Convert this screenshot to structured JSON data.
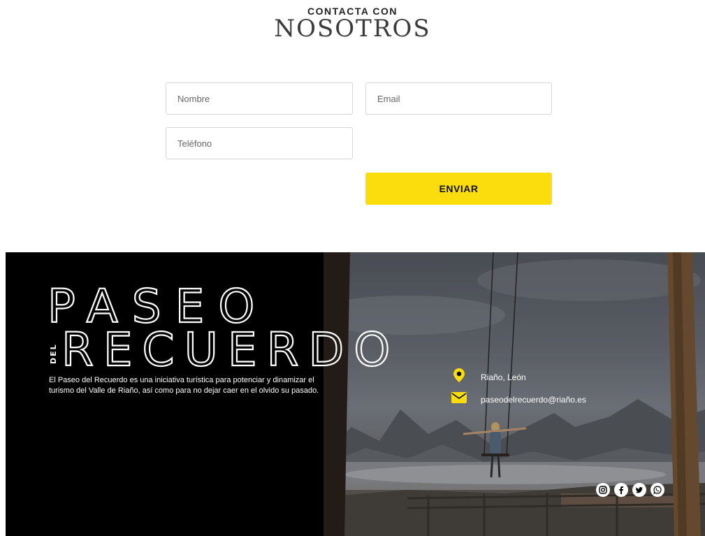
{
  "contact": {
    "heading_small": "CONTACTA CON",
    "heading_big": "NOSOTROS",
    "fields": {
      "name_placeholder": "Nombre",
      "email_placeholder": "Email",
      "phone_placeholder": "Teléfono"
    },
    "submit_label": "ENVIAR"
  },
  "footer": {
    "logo": {
      "line1": "PASEO",
      "prefix": "DEL",
      "line2": "RECUERDO"
    },
    "tagline": "El Paseo del Recuerdo es una iniciativa turística para potenciar y dinamizar el turismo del Valle de Riaño, así como para no dejar caer en el olvido su pasado.",
    "location": {
      "icon": "map-pin-icon",
      "text": "Riaño, León"
    },
    "email": {
      "icon": "envelope-icon",
      "text": "paseodelrecuerdo@riaño.es"
    },
    "social": [
      {
        "name": "instagram-icon"
      },
      {
        "name": "facebook-icon"
      },
      {
        "name": "twitter-icon"
      },
      {
        "name": "whatsapp-icon"
      }
    ]
  },
  "colors": {
    "accent": "#fbdc0c",
    "footer_bg": "#000000",
    "text_light": "#ffffff"
  }
}
